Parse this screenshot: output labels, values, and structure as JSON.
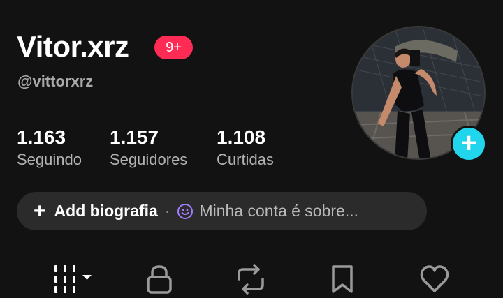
{
  "profile": {
    "display_name": "Vitor.xrz",
    "notification_badge": "9+",
    "username": "@vittorxrz"
  },
  "stats": {
    "following": {
      "value": "1.163",
      "label": "Seguindo"
    },
    "followers": {
      "value": "1.157",
      "label": "Seguidores"
    },
    "likes": {
      "value": "1.108",
      "label": "Curtidas"
    }
  },
  "bio": {
    "add_label": "Add biografia",
    "separator": "·",
    "hint": "Minha conta é sobre..."
  },
  "tabs": [
    {
      "icon": "grid-icon",
      "active": true
    },
    {
      "icon": "lock-icon",
      "active": false
    },
    {
      "icon": "repost-icon",
      "active": false
    },
    {
      "icon": "bookmark-icon",
      "active": false
    },
    {
      "icon": "heart-icon",
      "active": false
    }
  ],
  "colors": {
    "background": "#121212",
    "badge": "#fe2c55",
    "add_button": "#20d5ec",
    "pill": "#2b2b2b",
    "emoji": "#a17dfc"
  }
}
